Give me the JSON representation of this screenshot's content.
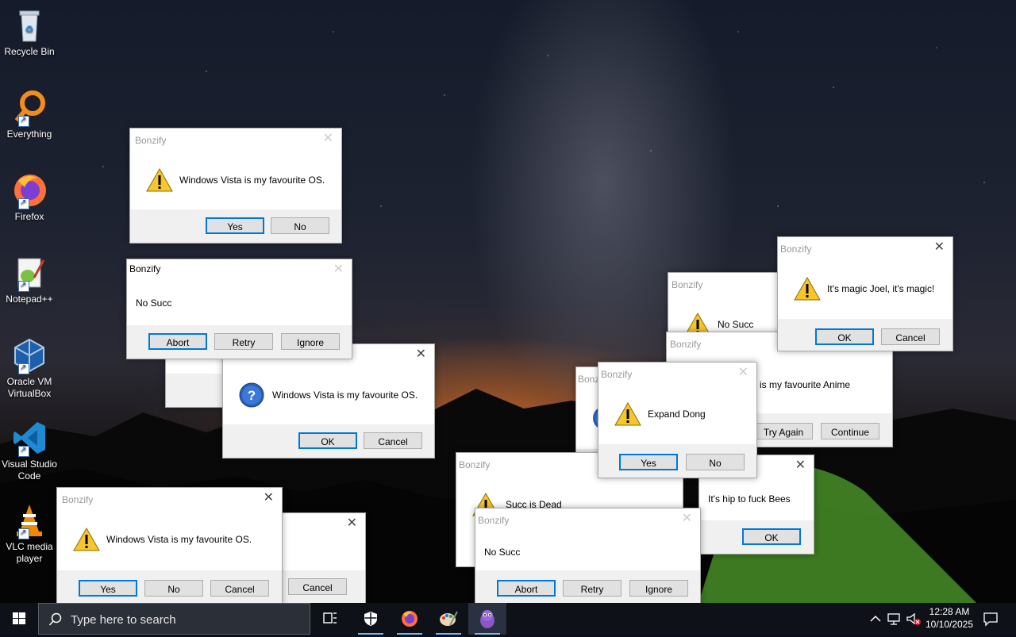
{
  "desktop": {
    "icons": [
      {
        "label": "Recycle Bin",
        "icon": "recycle-bin-icon"
      },
      {
        "label": "Everything",
        "icon": "everything-search-icon"
      },
      {
        "label": "Firefox",
        "icon": "firefox-icon"
      },
      {
        "label": "Notepad++",
        "icon": "notepadpp-icon"
      },
      {
        "label": "Oracle VM VirtualBox",
        "icon": "virtualbox-icon"
      },
      {
        "label": "Visual Studio Code",
        "icon": "vscode-icon"
      },
      {
        "label": "VLC media player",
        "icon": "vlc-icon"
      }
    ]
  },
  "dialogs": {
    "title": "Bonzify",
    "close_glyph": "✕",
    "d1": {
      "message": "Windows Vista is my favourite OS.",
      "buttons": [
        "Yes",
        "No"
      ]
    },
    "d2": {
      "message": "No Succ",
      "buttons": [
        "Abort",
        "Retry",
        "Ignore"
      ]
    },
    "d3": {
      "message": "Windows Vista is my favourite OS.",
      "buttons": [
        "OK",
        "Cancel"
      ]
    },
    "d4": {
      "message": "Windows Vista is my favourite OS.",
      "buttons": [
        "Yes",
        "No",
        "Cancel"
      ]
    },
    "d5": {
      "buttons": [
        "Cancel"
      ]
    },
    "d6": {
      "message": "No Succ"
    },
    "d7": {
      "message": "It's magic Joel, it's magic!",
      "buttons": [
        "OK",
        "Cancel"
      ]
    },
    "d8": {
      "message": "is my favourite Anime",
      "buttons": [
        "Try Again",
        "Continue"
      ]
    },
    "d9": {
      "title_partial": "Bonz"
    },
    "d10": {
      "message": "Expand Dong",
      "buttons": [
        "Yes",
        "No"
      ]
    },
    "d11": {
      "message": "Succ is Dead"
    },
    "d12": {
      "message": "It's hip to fuck Bees",
      "buttons": [
        "OK"
      ]
    },
    "d13": {
      "message": "No Succ",
      "buttons": [
        "Abort",
        "Retry",
        "Ignore"
      ]
    }
  },
  "taskbar": {
    "search_placeholder": "Type here to search",
    "pinned": [
      "task-view-icon",
      "security-shield-icon",
      "firefox-icon",
      "paint-icon",
      "bonzi-buddy-icon"
    ],
    "tray": [
      "chevron-up-icon",
      "network-icon",
      "volume-muted-icon"
    ],
    "time": "12:28 AM",
    "date": "10/10/2025",
    "accent": "#76b9ed"
  }
}
